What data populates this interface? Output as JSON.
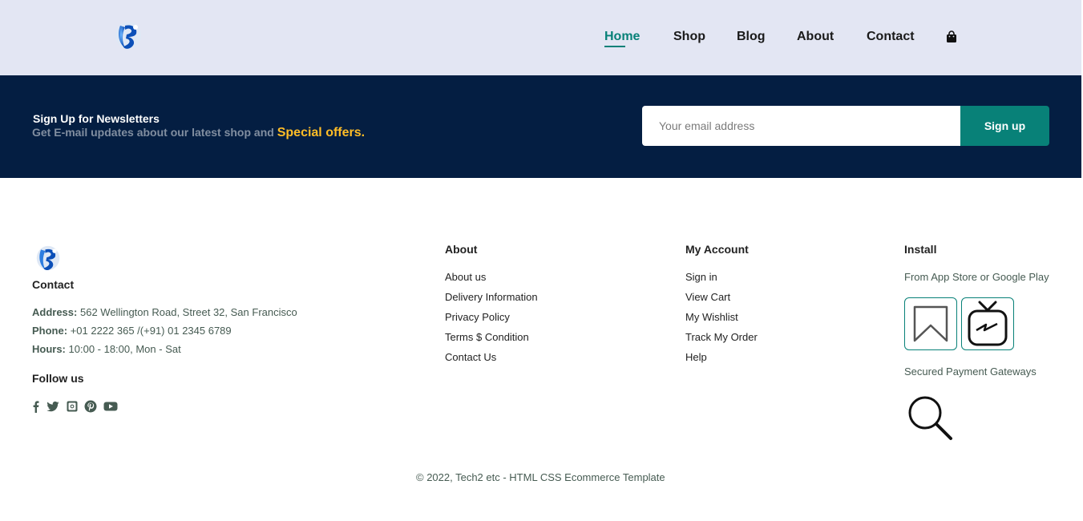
{
  "header": {
    "logo": "brand-logo",
    "nav": [
      {
        "label": "Home",
        "active": true
      },
      {
        "label": "Shop",
        "active": false
      },
      {
        "label": "Blog",
        "active": false
      },
      {
        "label": "About",
        "active": false
      },
      {
        "label": "Contact",
        "active": false
      }
    ],
    "cart_icon": "shopping-bag-icon",
    "accent_color": "#088178"
  },
  "newsletter": {
    "title": "Sign Up for Newsletters",
    "subtitle": "Get E-mail updates about our latest shop and",
    "highlight": "Special offers.",
    "email_placeholder": "Your email address",
    "button_label": "Sign up",
    "background_color": "#041e42",
    "highlight_color": "#ffbd27"
  },
  "footer": {
    "contact": {
      "heading": "Contact",
      "address_label": "Address:",
      "address": "562 Wellington Road, Street 32, San Francisco",
      "phone_label": "Phone:",
      "phone": "+01 2222 365 /(+91) 01 2345 6789",
      "hours_label": "Hours:",
      "hours": "10:00 - 18:00, Mon - Sat"
    },
    "follow": {
      "heading": "Follow us",
      "icons": [
        "facebook-icon",
        "twitter-icon",
        "instagram-icon",
        "pinterest-icon",
        "youtube-icon"
      ]
    },
    "about": {
      "heading": "About",
      "links": [
        "About us",
        "Delivery Information",
        "Privacy Policy",
        "Terms $ Condition",
        "Contact Us"
      ]
    },
    "account": {
      "heading": "My Account",
      "links": [
        "Sign in",
        "View Cart",
        "My Wishlist",
        "Track My Order",
        "Help"
      ]
    },
    "install": {
      "heading": "Install",
      "app_text": "From App Store or Google Play",
      "app_icons": [
        "bookmark-icon",
        "igtv-icon"
      ],
      "payment_text": "Secured Payment Gateways",
      "payment_icon": "search-icon"
    },
    "copyright": "© 2022, Tech2 etc - HTML CSS Ecommerce Template"
  }
}
